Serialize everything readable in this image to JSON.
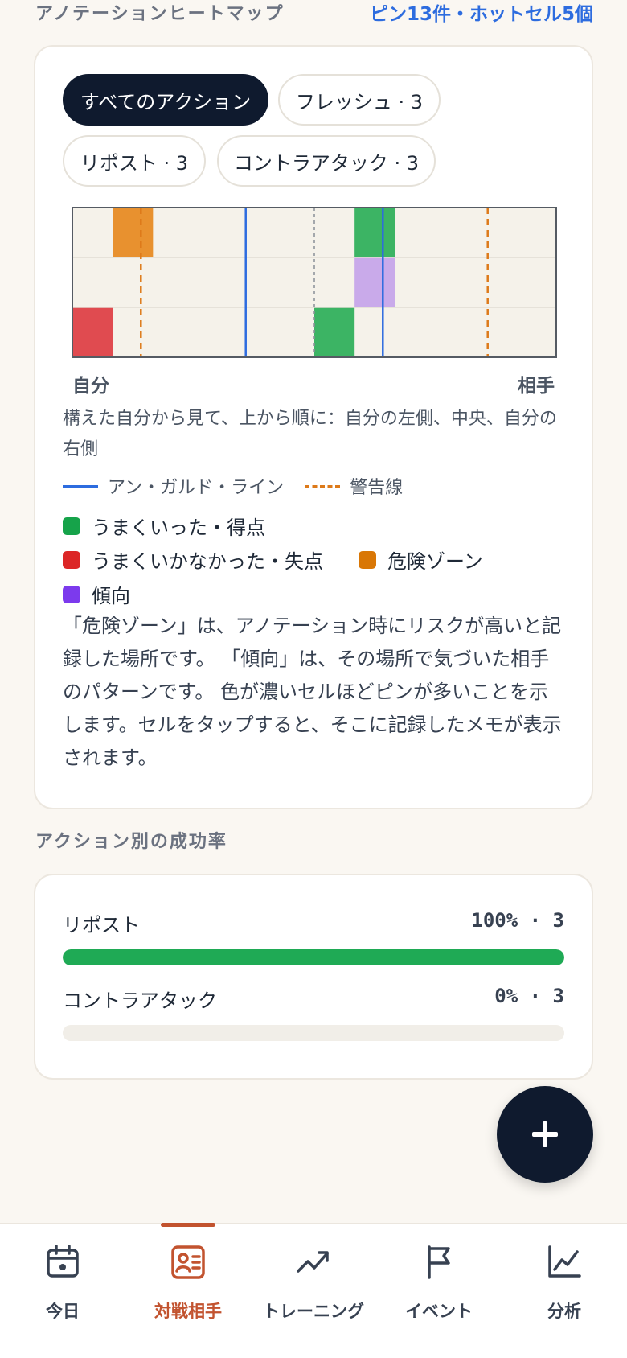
{
  "header": {
    "title": "アノテーションヒートマップ",
    "meta": "ピン13件・ホットセル5個"
  },
  "filters": [
    {
      "label": "すべてのアクション",
      "active": true
    },
    {
      "label": "フレッシュ · 3",
      "active": false
    },
    {
      "label": "リポスト · 3",
      "active": false
    },
    {
      "label": "コントラアタック · 3",
      "active": false
    }
  ],
  "heatmap": {
    "rows": 3,
    "cols": 12,
    "cells": [
      {
        "row": 0,
        "col": 1,
        "type": "danger"
      },
      {
        "row": 0,
        "col": 7,
        "type": "success"
      },
      {
        "row": 1,
        "col": 7,
        "type": "tendency"
      },
      {
        "row": 2,
        "col": 0,
        "type": "fail"
      },
      {
        "row": 2,
        "col": 6,
        "type": "success"
      }
    ],
    "left_label": "自分",
    "right_label": "相手",
    "orientation_note": "構えた自分から見て、上から順に：自分の左側、中央、自分の右側"
  },
  "legend": {
    "on_guard_line": "アン・ガルド・ライン",
    "warning_line": "警告線",
    "success": "うまくいった・得点",
    "fail": "うまくいかなかった・失点",
    "danger": "危険ゾーン",
    "tendency": "傾向"
  },
  "colors": {
    "success": "#3cb464",
    "fail": "#e04b50",
    "danger": "#e8912f",
    "tendency": "#c9aaea",
    "swatch_success": "#16a34a",
    "swatch_fail": "#dc2626",
    "swatch_danger": "#d97706",
    "swatch_tendency": "#7c3aed",
    "on_guard_line": "#2d6cdf",
    "warning_line": "#dd7a1a"
  },
  "description": "「危険ゾーン」は、アノテーション時にリスクが高いと記録した場所です。 「傾向」は、その場所で気づいた相手のパターンです。 色が濃いセルほどピンが多いことを示します。セルをタップすると、そこに記録したメモが表示されます。",
  "success_rate": {
    "title": "アクション別の成功率",
    "rows": [
      {
        "name": "リポスト",
        "value": "100% · 3",
        "rate": 1.0
      },
      {
        "name": "コントラアタック",
        "value": "0% · 3",
        "rate": 0.0
      }
    ]
  },
  "fab_icon": "plus-icon",
  "nav": [
    {
      "label": "今日",
      "icon": "calendar-icon",
      "active": false
    },
    {
      "label": "対戦相手",
      "icon": "opponent-card-icon",
      "active": true
    },
    {
      "label": "トレーニング",
      "icon": "trend-up-icon",
      "active": false
    },
    {
      "label": "イベント",
      "icon": "flag-icon",
      "active": false
    },
    {
      "label": "分析",
      "icon": "chart-icon",
      "active": false
    }
  ]
}
